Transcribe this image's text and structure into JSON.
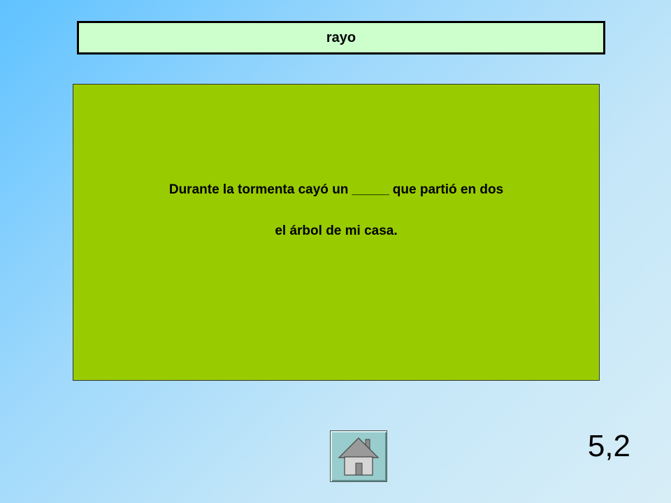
{
  "answer": {
    "text": "rayo"
  },
  "question": {
    "line1": "Durante la tormenta cayó un _____ que partió en dos",
    "line2": "el árbol de mi casa."
  },
  "navigation": {
    "home_icon": "house-icon"
  },
  "score": {
    "label": "5,2"
  },
  "colors": {
    "answer_bg": "#ccffcc",
    "panel_bg": "#99cc00",
    "home_button_bg": "#99cccc"
  }
}
